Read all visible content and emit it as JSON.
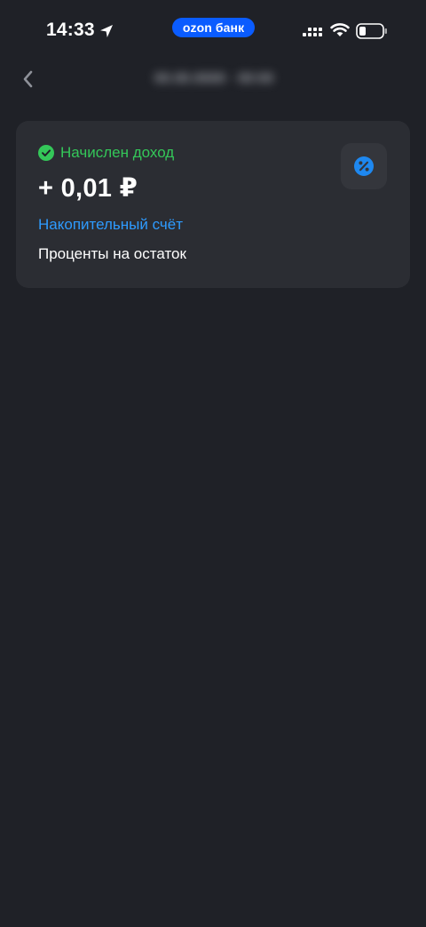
{
  "status_bar": {
    "time": "14:33",
    "bank_pill": "ozon банк",
    "icons": [
      "location-arrow-icon",
      "cellular-signal-icon",
      "wifi-icon",
      "battery-icon"
    ]
  },
  "header": {
    "back_icon": "chevron-left-icon",
    "title": "00.00.0000 · 00:00"
  },
  "operation": {
    "status": "Начислен доход",
    "status_icon": "check-circle-icon",
    "status_color": "#34c759",
    "amount": "+ 0,01 ₽",
    "account": "Накопительный счёт",
    "account_color": "#2e9bff",
    "description": "Проценты на остаток",
    "category_icon": "percent-icon",
    "category_icon_color": "#1e88f0"
  },
  "colors": {
    "background": "#1f2127",
    "card": "#2b2d33",
    "brand": "#0a5cff"
  }
}
